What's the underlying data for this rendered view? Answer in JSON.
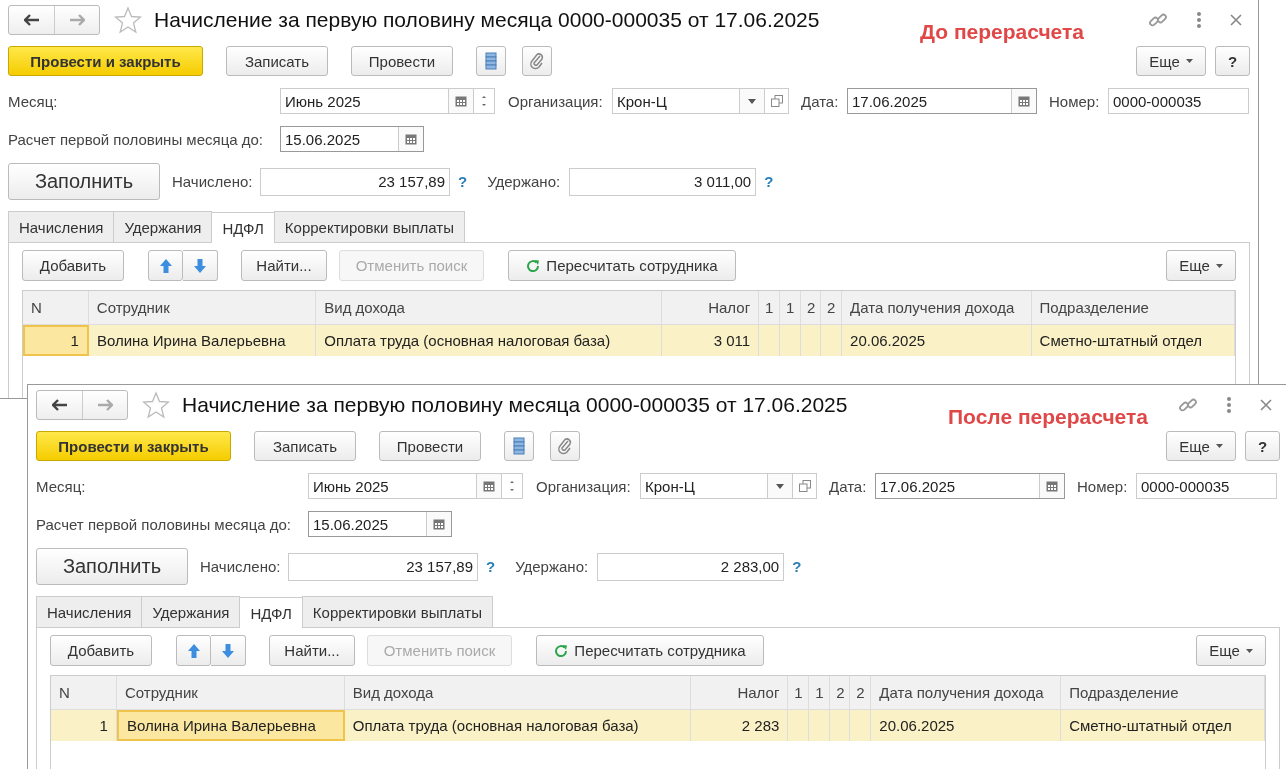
{
  "windows": [
    {
      "title": "Начисление за первую половину месяца 0000-000035 от 17.06.2025",
      "annotation": "До перерасчета",
      "toolbar": [
        {
          "label": "Провести и закрыть",
          "kind": "primary"
        },
        {
          "label": "Записать",
          "kind": "plain"
        },
        {
          "label": "Провести",
          "kind": "plain"
        }
      ],
      "more": "Еще",
      "help": "?",
      "fields": [
        {
          "label": "Месяц:",
          "value": "Июнь 2025",
          "kind": "month"
        },
        {
          "label": "Организация:",
          "value": "Крон-Ц",
          "kind": "select"
        },
        {
          "label": "Дата:",
          "value": "17.06.2025",
          "kind": "date"
        },
        {
          "label": "Номер:",
          "value": "0000-000035",
          "kind": "text"
        }
      ],
      "period": {
        "label": "Расчет первой половины месяца до:",
        "value": "15.06.2025"
      },
      "fill_button": "Заполнить",
      "totals": [
        {
          "label": "Начислено:",
          "value": "23 157,89",
          "hint": "?"
        },
        {
          "label": "Удержано:",
          "value": "3 011,00",
          "hint": "?"
        }
      ],
      "tabs": [
        {
          "label": "Начисления",
          "selected": false
        },
        {
          "label": "Удержания",
          "selected": false
        },
        {
          "label": "НДФЛ",
          "selected": true
        },
        {
          "label": "Корректировки выплаты",
          "selected": false
        }
      ],
      "table_toolbar": {
        "add": "Добавить",
        "find": "Найти...",
        "cancel_search": {
          "label": "Отменить поиск",
          "disabled": true
        },
        "recalc": "Пересчитать сотрудника",
        "more": "Еще"
      },
      "table": {
        "columns": [
          {
            "label": "N",
            "kind": "number"
          },
          {
            "label": "Сотрудник",
            "kind": "text"
          },
          {
            "label": "Вид дохода",
            "kind": "text"
          },
          {
            "label": "Налог",
            "kind": "number"
          },
          {
            "label": "1",
            "kind": "narrow"
          },
          {
            "label": "1",
            "kind": "narrow"
          },
          {
            "label": "2",
            "kind": "narrow"
          },
          {
            "label": "2",
            "kind": "narrow"
          },
          {
            "label": "Дата получения дохода",
            "kind": "text"
          },
          {
            "label": "Подразделение",
            "kind": "text"
          }
        ],
        "rows": [
          {
            "cells": [
              {
                "text": "1",
                "selected": true
              },
              {
                "text": "Волина Ирина Валерьевна",
                "selected": false
              },
              {
                "text": "Оплата труда (основная налоговая база)",
                "selected": false
              },
              {
                "text": "3 011",
                "selected": false
              },
              {
                "text": "",
                "selected": false
              },
              {
                "text": "",
                "selected": false
              },
              {
                "text": "",
                "selected": false
              },
              {
                "text": "",
                "selected": false
              },
              {
                "text": "20.06.2025",
                "selected": false
              },
              {
                "text": "Сметно-штатный отдел",
                "selected": false
              }
            ]
          }
        ]
      }
    },
    {
      "title": "Начисление за первую половину месяца 0000-000035 от 17.06.2025",
      "annotation": "После перерасчета",
      "toolbar": [
        {
          "label": "Провести и закрыть",
          "kind": "primary"
        },
        {
          "label": "Записать",
          "kind": "plain"
        },
        {
          "label": "Провести",
          "kind": "plain"
        }
      ],
      "more": "Еще",
      "help": "?",
      "fields": [
        {
          "label": "Месяц:",
          "value": "Июнь 2025",
          "kind": "month"
        },
        {
          "label": "Организация:",
          "value": "Крон-Ц",
          "kind": "select"
        },
        {
          "label": "Дата:",
          "value": "17.06.2025",
          "kind": "date"
        },
        {
          "label": "Номер:",
          "value": "0000-000035",
          "kind": "text"
        }
      ],
      "period": {
        "label": "Расчет первой половины месяца до:",
        "value": "15.06.2025"
      },
      "fill_button": "Заполнить",
      "totals": [
        {
          "label": "Начислено:",
          "value": "23 157,89",
          "hint": "?"
        },
        {
          "label": "Удержано:",
          "value": "2 283,00",
          "hint": "?"
        }
      ],
      "tabs": [
        {
          "label": "Начисления",
          "selected": false
        },
        {
          "label": "Удержания",
          "selected": false
        },
        {
          "label": "НДФЛ",
          "selected": true
        },
        {
          "label": "Корректировки выплаты",
          "selected": false
        }
      ],
      "table_toolbar": {
        "add": "Добавить",
        "find": "Найти...",
        "cancel_search": {
          "label": "Отменить поиск",
          "disabled": true
        },
        "recalc": "Пересчитать сотрудника",
        "more": "Еще"
      },
      "table": {
        "columns": [
          {
            "label": "N",
            "kind": "number"
          },
          {
            "label": "Сотрудник",
            "kind": "text"
          },
          {
            "label": "Вид дохода",
            "kind": "text"
          },
          {
            "label": "Налог",
            "kind": "number"
          },
          {
            "label": "1",
            "kind": "narrow"
          },
          {
            "label": "1",
            "kind": "narrow"
          },
          {
            "label": "2",
            "kind": "narrow"
          },
          {
            "label": "2",
            "kind": "narrow"
          },
          {
            "label": "Дата получения дохода",
            "kind": "text"
          },
          {
            "label": "Подразделение",
            "kind": "text"
          }
        ],
        "rows": [
          {
            "cells": [
              {
                "text": "1",
                "selected": false
              },
              {
                "text": "Волина Ирина Валерьевна",
                "selected": true
              },
              {
                "text": "Оплата труда (основная налоговая база)",
                "selected": false
              },
              {
                "text": "2 283",
                "selected": false
              },
              {
                "text": "",
                "selected": false
              },
              {
                "text": "",
                "selected": false
              },
              {
                "text": "",
                "selected": false
              },
              {
                "text": "",
                "selected": false
              },
              {
                "text": "20.06.2025",
                "selected": false
              },
              {
                "text": "Сметно-штатный отдел",
                "selected": false
              }
            ]
          }
        ]
      }
    }
  ]
}
